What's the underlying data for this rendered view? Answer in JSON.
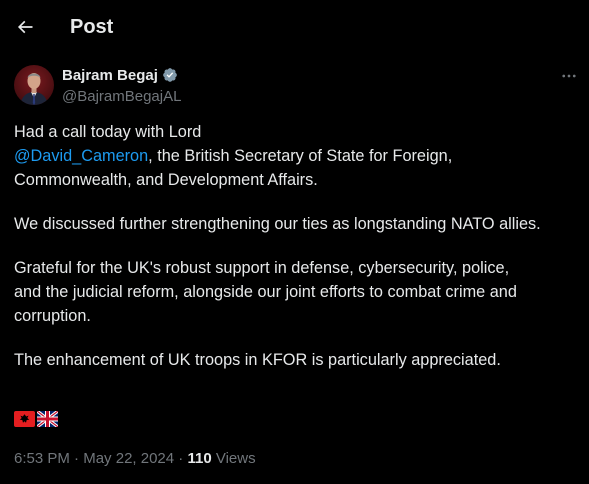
{
  "header": {
    "title": "Post",
    "back_icon": "arrow-left-icon"
  },
  "author": {
    "name": "Bajram Begaj",
    "handle": "@BajramBegajAL",
    "verified_icon": "verified-badge-icon",
    "verified_color": "#829aab"
  },
  "more_icon": "more-horizontal-icon",
  "tweet": {
    "line_1": "Had a call today with Lord",
    "mention": "@David_Cameron",
    "line_2_rest": ", the British Secretary of State for Foreign,",
    "line_3": "Commonwealth, and Development Affairs.",
    "paragraph_2": "We discussed further strengthening our ties as longstanding NATO allies.",
    "paragraph_3_line_1": "Grateful for the UK's robust support in defense, cybersecurity, police,",
    "paragraph_3_line_2": "and the judicial reform, alongside our joint efforts to combat crime and",
    "paragraph_3_line_3": "corruption.",
    "paragraph_4": "The enhancement of UK troops in KFOR is particularly appreciated.",
    "flags": [
      "albania-flag-icon",
      "uk-flag-icon"
    ]
  },
  "meta": {
    "time": "6:53 PM",
    "separator_1": " · ",
    "date": "May 22, 2024",
    "separator_2": " · ",
    "views_count": "110",
    "views_label": " Views"
  },
  "colors": {
    "background": "#000000",
    "text": "#e7e9ea",
    "secondary_text": "#71767b",
    "link": "#1d9bf0"
  }
}
